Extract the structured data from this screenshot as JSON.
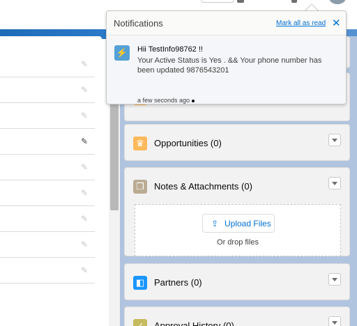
{
  "notifications": {
    "title": "Notifications",
    "mark_all_read": "Mark all as read",
    "close_glyph": "✕",
    "item": {
      "icon": "lightning-bolt-icon",
      "icon_glyph": "⚡",
      "heading": "Hii TestInfo98762 !!",
      "body": "Your Active Status is Yes . && Your phone number has been updated 9876543201",
      "time": "a few seconds ago"
    }
  },
  "related_lists": {
    "opportunities": {
      "title": "Opportunities (0)",
      "icon": "crown-icon",
      "icon_glyph": "♛",
      "color": "#fcb95b"
    },
    "notes": {
      "title": "Notes & Attachments (0)",
      "icon": "notes-icon",
      "icon_glyph": "❐",
      "color": "#baac93",
      "upload_label": "Upload Files",
      "upload_icon": "upload-icon",
      "upload_glyph": "⇪",
      "drop_text": "Or drop files"
    },
    "partners": {
      "title": "Partners (0)",
      "icon": "partners-icon",
      "icon_glyph": "◧",
      "color": "#1b96ff"
    },
    "approval": {
      "title": "Approval History (0)",
      "icon": "approval-icon",
      "icon_glyph": "✓",
      "color": "#c5bb5f"
    }
  },
  "left_fields": {
    "edit_icon": "pencil-icon",
    "edit_glyph": "✎"
  },
  "colors": {
    "brand_blue": "#0070d2",
    "banner": "#1f6bb8"
  }
}
